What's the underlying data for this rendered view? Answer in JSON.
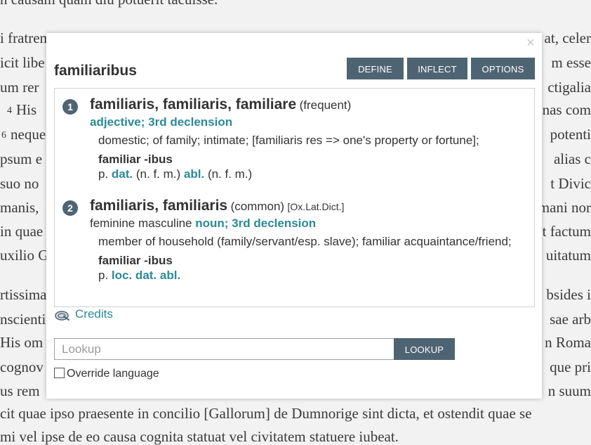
{
  "background_text": [
    {
      "left": "n causam quam diu potuerit tacuisse.",
      "right": ""
    },
    {
      "left": "i fratrem",
      "right": "at, celer"
    },
    {
      "left": "icit libe",
      "right": "m esse"
    },
    {
      "left": "um rer",
      "right": "ctigalia"
    },
    {
      "num": "4",
      "left": "His",
      "right": "nas com"
    },
    {
      "num": "6",
      "left": "neque",
      "right": "potenti"
    },
    {
      "left": "psum e",
      "right": "alias c"
    },
    {
      "left": "suo no",
      "right": "t Divic"
    },
    {
      "left": "manis,",
      "right": "mani nor"
    },
    {
      "left": "in quae",
      "right": "t factum"
    },
    {
      "left": "uxilio G",
      "right": "uitatum"
    },
    {
      "left": "rtissima",
      "right": "bsides i"
    },
    {
      "left": "nscienti",
      "right": "sae arb"
    },
    {
      "left": "His om",
      "right": "n Roma"
    },
    {
      "left": "cognov",
      "right": "que pri"
    },
    {
      "left": "us rem",
      "right": "n suum"
    },
    {
      "left": "cit quae ipso praesente in concilio [Gallorum] de Dumnorige sint dicta, et ostendit quae se",
      "right": ""
    },
    {
      "left": "mi vel ipse de eo causa cognita statuat vel civitatem statuere iubeat.",
      "right": ""
    }
  ],
  "dialog": {
    "close_glyph": "×",
    "word": "familiaribus",
    "buttons": {
      "define": "DEFINE",
      "inflect": "INFLECT",
      "options": "OPTIONS"
    },
    "entries": [
      {
        "number": "1",
        "lemma": "familiaris, familiaris, familiare",
        "frequency": "(frequent)",
        "source": "",
        "gender": "",
        "pos": "adjective; 3rd declension",
        "sense": "domestic; of family; intimate; [familiaris res => one's property or fortune];",
        "stem": "familiar -ibus",
        "infl_prefix": "p.",
        "infl_a": "dat.",
        "infl_a_note": "(n. f. m.)",
        "infl_b": "abl.",
        "infl_b_note": "(n. f. m.)"
      },
      {
        "number": "2",
        "lemma": "familiaris, familiaris",
        "frequency": "(common)",
        "source": "[Ox.Lat.Dict.]",
        "gender": "feminine masculine",
        "pos": "noun; 3rd declension",
        "sense": "member of household (family/servant/esp. slave); familiar acquaintance/friend;",
        "stem": "familiar -ibus",
        "infl_prefix": "p.",
        "infl_a": "loc. dat. abl."
      }
    ],
    "credits_label": "Credits",
    "lookup_placeholder": "Lookup",
    "lookup_value": "",
    "lookup_button": "LOOKUP",
    "override_label": "Override language",
    "override_checked": false
  },
  "colors": {
    "button": "#4f6472",
    "accent": "#2b8a96"
  },
  "icons": {
    "close": "close-icon",
    "credits": "credits-icon",
    "checkbox": "checkbox-icon"
  }
}
